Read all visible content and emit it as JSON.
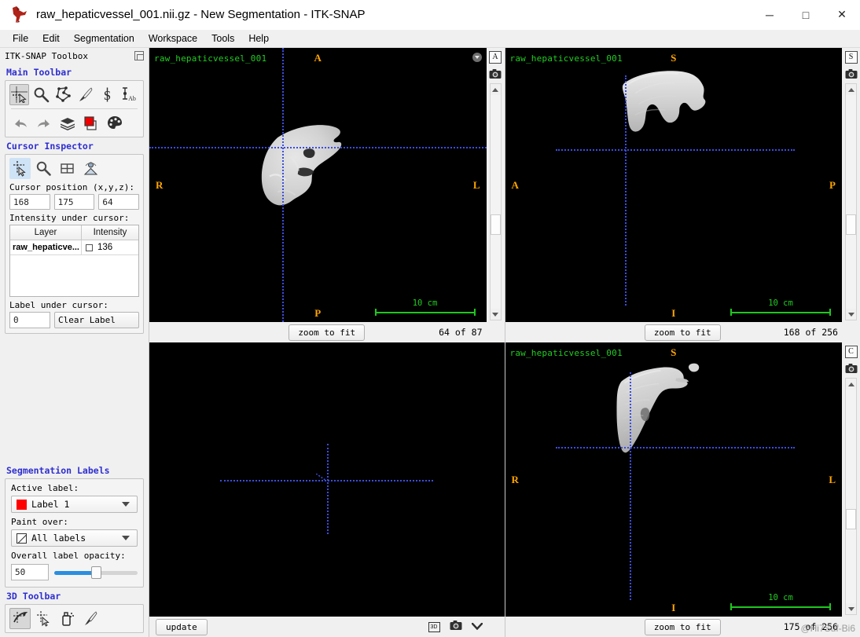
{
  "window": {
    "title": "raw_hepaticvessel_001.nii.gz - New Segmentation - ITK-SNAP",
    "app_icon": "itksnap-logo-icon",
    "minimize_glyph": "─",
    "maximize_glyph": "□",
    "close_glyph": "✕"
  },
  "menubar": {
    "items": [
      {
        "label": "File"
      },
      {
        "label": "Edit"
      },
      {
        "label": "Segmentation"
      },
      {
        "label": "Workspace"
      },
      {
        "label": "Tools"
      },
      {
        "label": "Help"
      }
    ]
  },
  "toolbox": {
    "header": "ITK-SNAP Toolbox",
    "float_icon": "undock-icon",
    "main_toolbar": {
      "title": "Main Toolbar",
      "tools_row1": [
        {
          "name": "crosshair-tool",
          "active": true
        },
        {
          "name": "zoom-pan-tool",
          "active": false
        },
        {
          "name": "polygon-tool",
          "active": false
        },
        {
          "name": "paintbrush-tool",
          "active": false
        },
        {
          "name": "snake-tool",
          "active": false
        },
        {
          "name": "annotation-tool",
          "active": false
        }
      ],
      "tools_row2": [
        {
          "name": "undo-icon"
        },
        {
          "name": "redo-icon"
        },
        {
          "name": "layers-icon"
        },
        {
          "name": "label-color-icon"
        },
        {
          "name": "palette-icon"
        }
      ]
    },
    "cursor_inspector": {
      "title": "Cursor Inspector",
      "tabs": [
        {
          "name": "cursor-tab",
          "active": true
        },
        {
          "name": "zoom-tab",
          "active": false
        },
        {
          "name": "layout-tab",
          "active": false
        },
        {
          "name": "display-tab",
          "active": false
        }
      ],
      "cursor_position_label": "Cursor position (x,y,z):",
      "cursor_position": {
        "x": "168",
        "y": "175",
        "z": "64"
      },
      "intensity_label": "Intensity under cursor:",
      "intensity_table": {
        "columns": [
          "Layer",
          "Intensity"
        ],
        "rows": [
          {
            "layer": "raw_hepaticve...",
            "intensity": "136"
          }
        ]
      },
      "label_under_cursor_label": "Label under cursor:",
      "label_value": "0",
      "clear_label_button": "Clear Label"
    },
    "segmentation_labels": {
      "title": "Segmentation Labels",
      "active_label_caption": "Active label:",
      "active_label_value": "Label 1",
      "active_label_color": "#ff0000",
      "paint_over_caption": "Paint over:",
      "paint_over_value": "All labels",
      "opacity_caption": "Overall label opacity:",
      "opacity_value": "50",
      "opacity_percent": 50
    },
    "toolbar_3d": {
      "title": "3D Toolbar",
      "tools": [
        {
          "name": "trackball-3d-tool",
          "active": true
        },
        {
          "name": "crosshair-3d-tool",
          "active": false
        },
        {
          "name": "spray-3d-tool",
          "active": false
        },
        {
          "name": "scalpel-3d-tool",
          "active": false
        }
      ]
    }
  },
  "viewports": [
    {
      "id": "axial",
      "plane_badge": "A",
      "image_name": "raw_hepaticvessel_001",
      "dir_top": "A",
      "dir_bottom": "P",
      "dir_left": "R",
      "dir_right": "L",
      "ruler": "10 cm",
      "zoom_button": "zoom to fit",
      "slice_text": "64 of 87",
      "camera_icon": "camera-icon",
      "has_gear": true
    },
    {
      "id": "sagittal",
      "plane_badge": "S",
      "image_name": "raw_hepaticvessel_001",
      "dir_top": "S",
      "dir_bottom": "I",
      "dir_left": "A",
      "dir_right": "P",
      "ruler": "10 cm",
      "zoom_button": "zoom to fit",
      "slice_text": "168 of 256",
      "camera_icon": "camera-icon",
      "has_gear": false
    },
    {
      "id": "render3d",
      "update_button": "update",
      "badge_3d": "3D",
      "camera_icon": "camera-icon",
      "chevron_icon": "chevron-down-icon"
    },
    {
      "id": "coronal",
      "plane_badge": "C",
      "image_name": "raw_hepaticvessel_001",
      "dir_top": "S",
      "dir_bottom": "I",
      "dir_left": "R",
      "dir_right": "L",
      "ruler": "10 cm",
      "zoom_button": "zoom to fit",
      "slice_text": "175 of 256",
      "camera_icon": "camera-icon",
      "has_gear": false
    }
  ],
  "watermark": "@Hi7Suf-Bi6",
  "colors": {
    "accent_blue": "#2f2fd0",
    "crosshair": "#3b4ee0",
    "overlay_green": "#22cc22",
    "direction_orange": "#ffa500",
    "label_red": "#ff0000",
    "canvas_bg": "#000000",
    "chrome_bg": "#f0f0f0"
  }
}
